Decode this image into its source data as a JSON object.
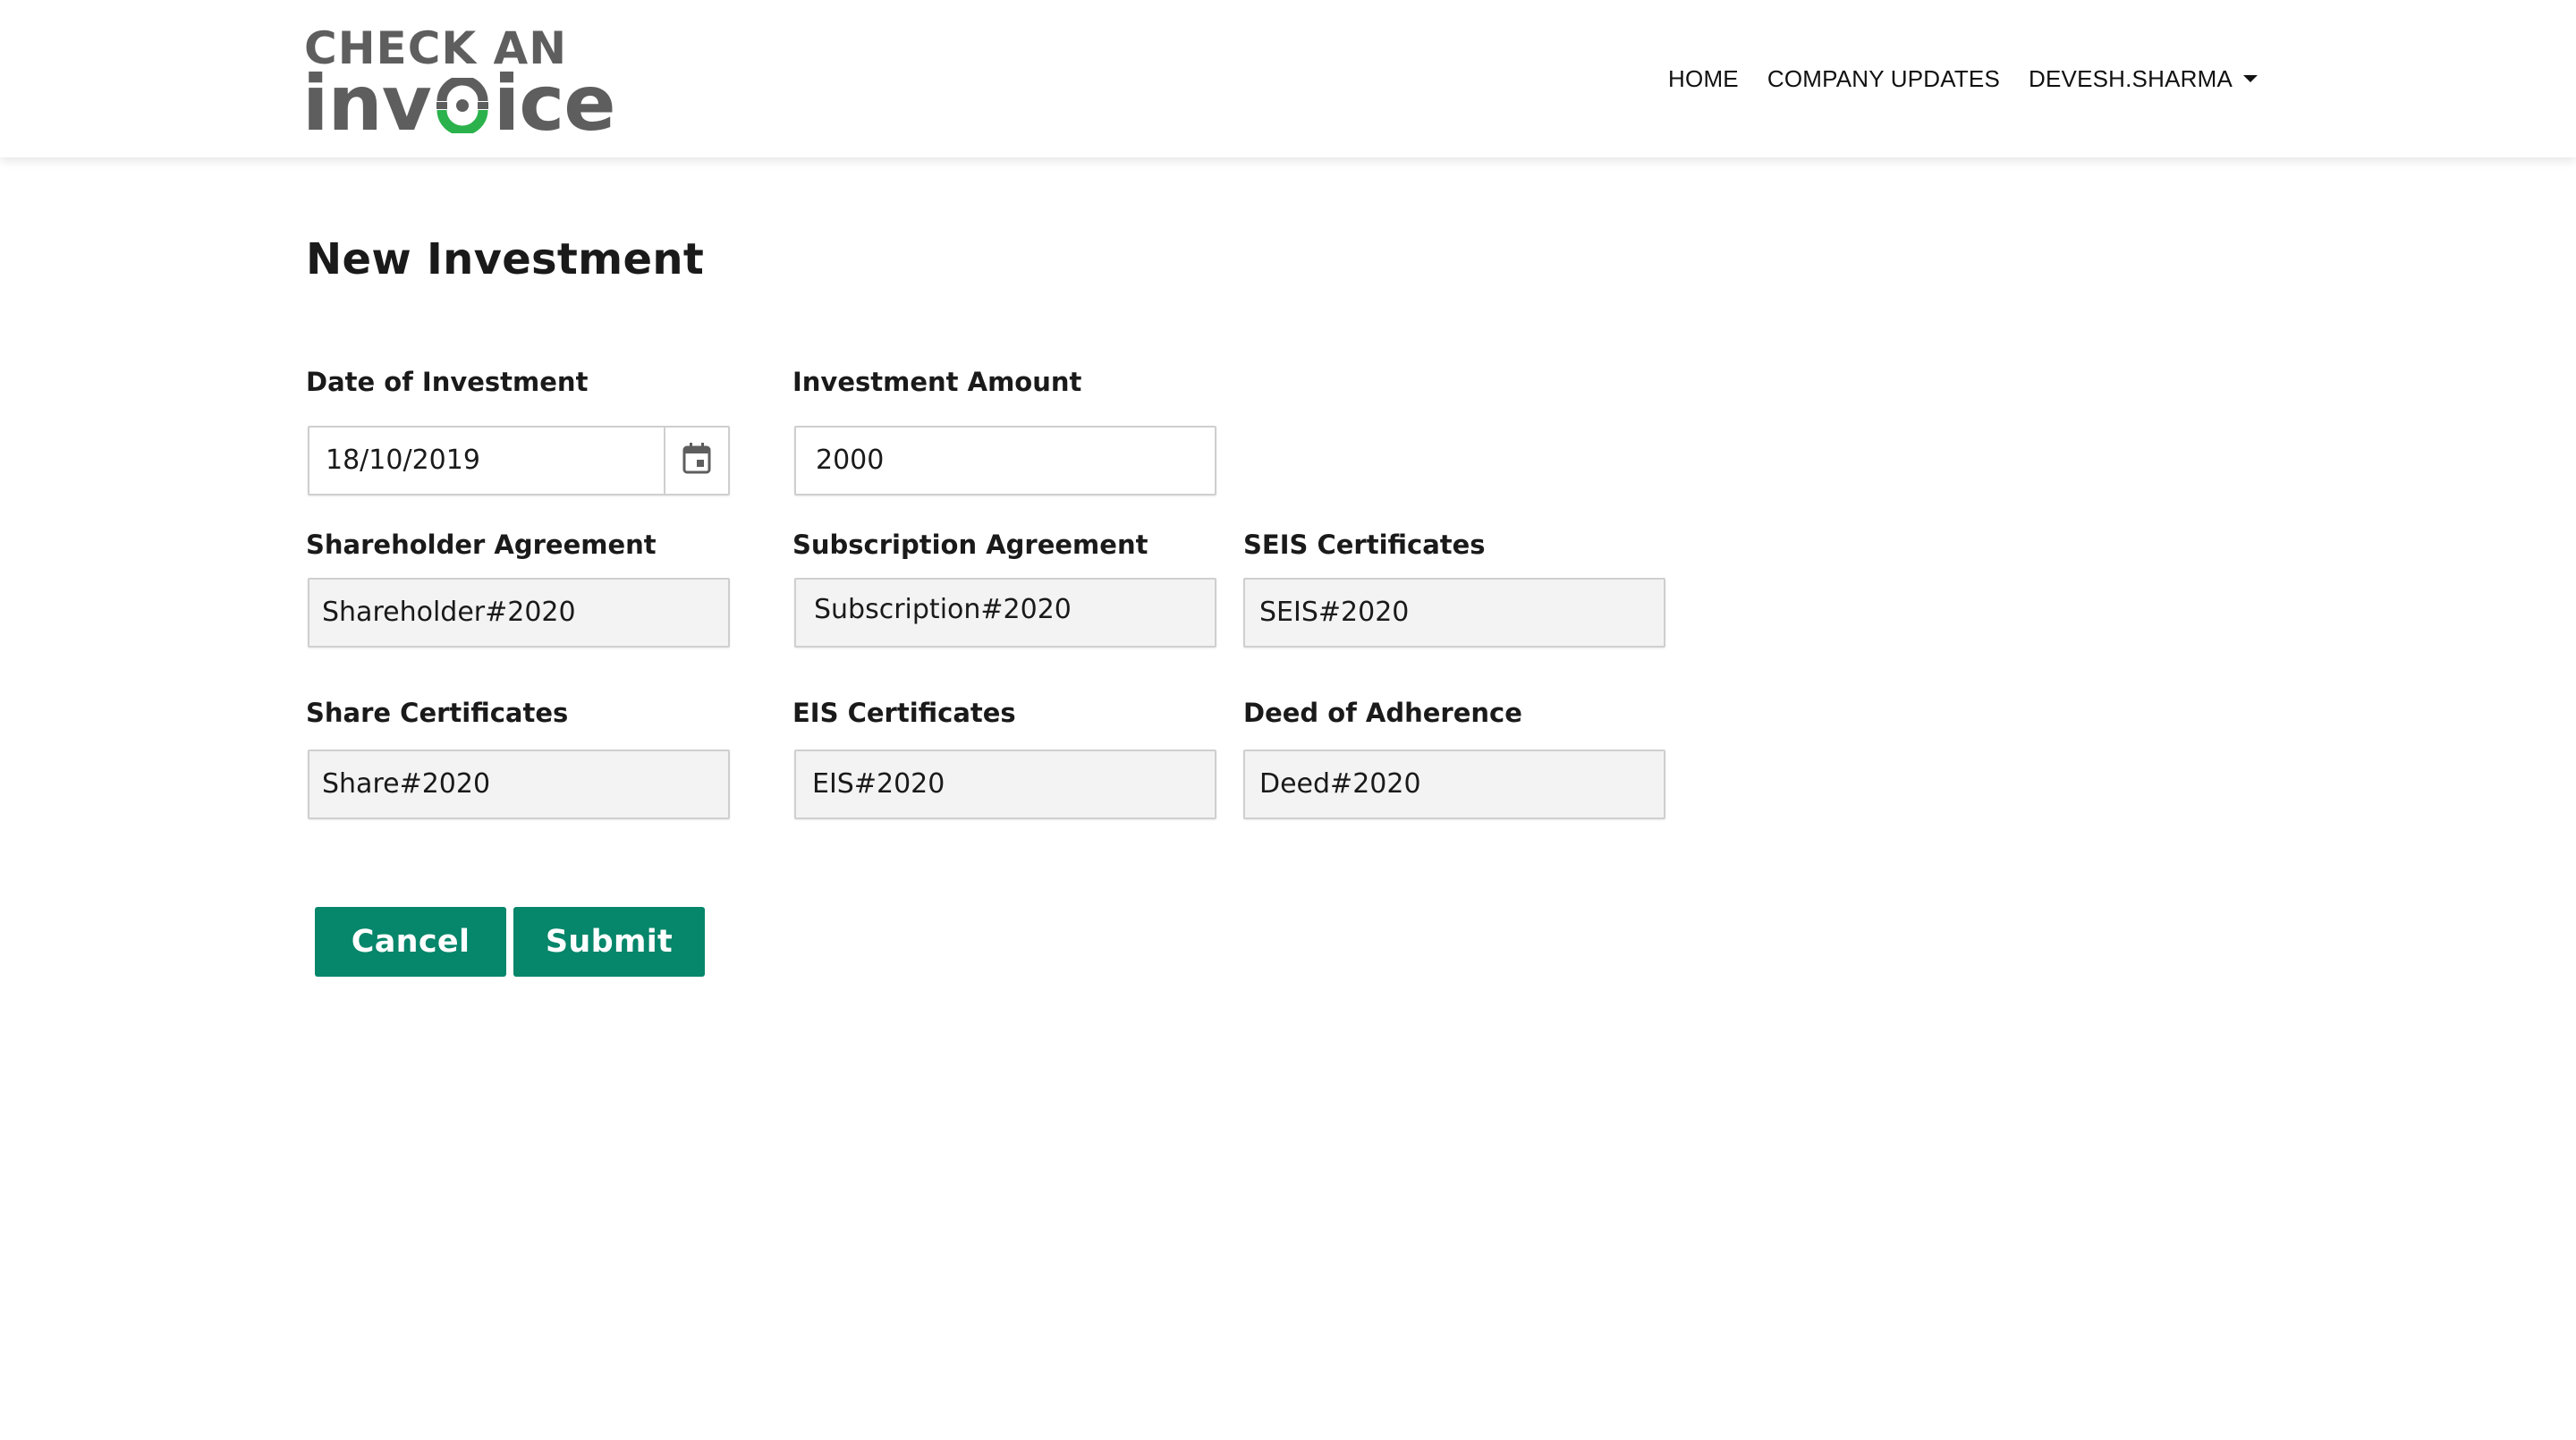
{
  "brand": {
    "line1": "CHECK AN",
    "line2_a": "inv",
    "line2_b": "ice"
  },
  "nav": {
    "home": "HOME",
    "company_updates": "COMPANY UPDATES",
    "user": "DEVESH.SHARMA"
  },
  "page": {
    "title": "New Investment"
  },
  "form": {
    "date_of_investment": {
      "label": "Date of Investment",
      "value": "18/10/2019"
    },
    "investment_amount": {
      "label": "Investment Amount",
      "value": "2000"
    },
    "shareholder_agreement": {
      "label": "Shareholder Agreement",
      "value": "Shareholder#2020"
    },
    "subscription_agreement": {
      "label": "Subscription Agreement",
      "value": "Subscription#2020"
    },
    "seis_certificates": {
      "label": "SEIS Certificates",
      "value": "SEIS#2020"
    },
    "share_certificates": {
      "label": "Share Certificates",
      "value": "Share#2020"
    },
    "eis_certificates": {
      "label": "EIS Certificates",
      "value": "EIS#2020"
    },
    "deed_of_adherence": {
      "label": "Deed of Adherence",
      "value": "Deed#2020"
    }
  },
  "buttons": {
    "cancel": "Cancel",
    "submit": "Submit"
  },
  "colors": {
    "brand_green": "#06866a",
    "logo_gray": "#5e5e5e",
    "logo_accent": "#2bb24c"
  },
  "icons": {
    "date_picker": "calendar-icon",
    "user_menu": "caret-down-icon"
  }
}
